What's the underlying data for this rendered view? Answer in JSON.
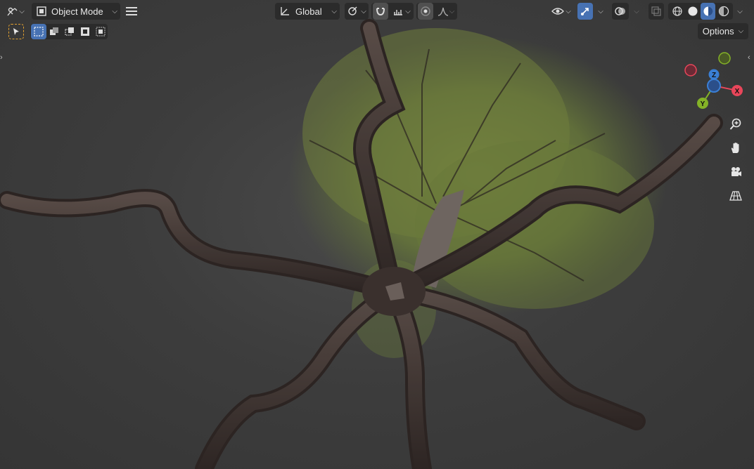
{
  "header": {
    "mode_label": "Object Mode",
    "transform_orientation_label": "Global",
    "options_label": "Options"
  },
  "icons": {
    "editor_type": "view3d-icon",
    "mode": "object-mode-icon",
    "menu": "hamburger-menu-icon",
    "orientation": "orientation-axes-icon",
    "pivot": "pivot-point-icon",
    "snap": "snap-magnet-icon",
    "snap_target": "snap-increment-icon",
    "proportional": "proportional-edit-icon",
    "falloff": "falloff-curve-icon",
    "visibility": "eye-visibility-icon",
    "gizmos": "gizmo-toggle-icon",
    "overlays": "overlay-circles-icon",
    "xray": "xray-icon",
    "shading_wire": "shading-wireframe-icon",
    "shading_solid": "shading-solid-icon",
    "shading_material": "shading-material-icon",
    "shading_rendered": "shading-rendered-icon",
    "zoom": "zoom-icon",
    "pan": "hand-pan-icon",
    "camera": "camera-view-icon",
    "ortho": "perspective-grid-icon"
  },
  "gizmo": {
    "x_label": "X",
    "y_label": "Y",
    "z_label": "Z"
  },
  "colors": {
    "accent_blue": "#4772b3",
    "axis_x": "#e8465a",
    "axis_y": "#84b327",
    "axis_z": "#3a7fd5",
    "foliage": "#6b7a3a",
    "bark": "#3e3431"
  }
}
